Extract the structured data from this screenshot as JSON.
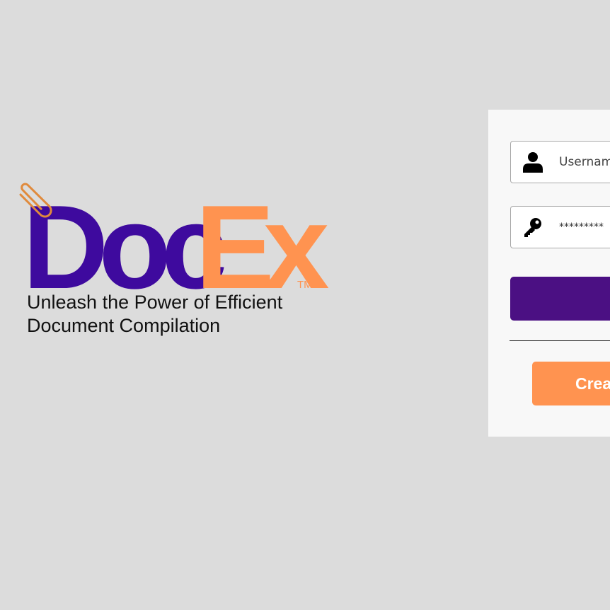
{
  "brand": {
    "wordmark_part1": "Doc",
    "wordmark_part2": "Ex",
    "trademark": "TM",
    "tagline_line1": "Unleash the Power of Efficient",
    "tagline_line2": "Document Compilation",
    "colors": {
      "primary_purple": "#3e0a9e",
      "accent_orange": "#ff9350",
      "paperclip": "#e08a3c"
    }
  },
  "login": {
    "username_placeholder": "Usernam",
    "username_icon": "user-icon",
    "password_value": "*********",
    "password_icon": "key-icon",
    "login_button_label": "",
    "create_button_label": "Crea",
    "colors": {
      "login_button": "#4b1083",
      "create_button": "#ff9350",
      "panel_background": "#f8f8f8",
      "page_background": "#dcdcdc"
    }
  }
}
